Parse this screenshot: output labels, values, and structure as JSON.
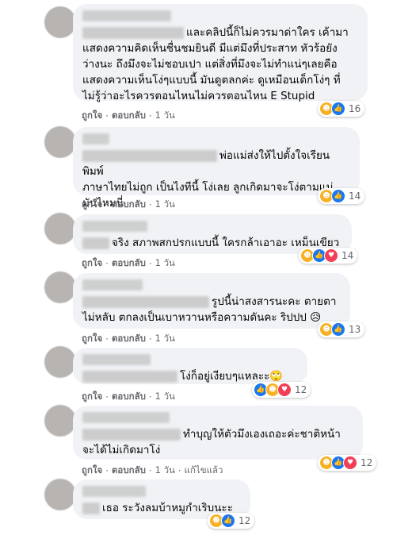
{
  "actions": {
    "like": "ถูกใจ",
    "reply": "ตอบกลับ",
    "sep": "·"
  },
  "comments": [
    {
      "lines": [
        "และคลิปนี้ก็ไม่ควรมาด่าใคร เค้ามา",
        "แสดงความคิดเห็นชื่นชมยินดี มีแต่มึงที่ประสาท หัวร้อยัง",
        "ว่างนะ ถึงมึงจะไม่ชอบเปา แต่สิ่งที่มึงจะไม่ทำแน่ๆเลยคือ",
        "แสดงความเห็นโง่ๆแบบนี้ มันดูตลกค่ะ ดูเหมือนเด็กโง่ๆ ที่",
        "ไม่รู้ว่าอะไรควรตอนไหนไม่ควรตอนไหน E Stupid"
      ],
      "time": "1 วัน",
      "count": "16",
      "reactions": [
        "haha",
        "like"
      ]
    },
    {
      "lines": [
        "พ่อแม่ส่งให้ไปตั้งใจเรียน พิมพ์",
        "ภาษาไทยไม่ถูก เป็นไงทีนี้ โง่เลย ลูกเกิดมาจะโง่ตามแม่",
        "มันไหมนี่"
      ],
      "time": "1 วัน",
      "count": "14",
      "reactions": [
        "haha",
        "like"
      ]
    },
    {
      "lines": [
        "จริง สภาพสกปรกแบบนี้ ใครกล้าเอาอะ เหม็นเขียว"
      ],
      "time": "1 วัน",
      "count": "14",
      "reactions": [
        "haha",
        "like",
        "love"
      ]
    },
    {
      "lines": [
        "รูปนี้น่าสงสารนะคะ ตายตา",
        "ไม่หลับ ตกลงเป็นเบาหวานหรือความดันคะ ริปปป 😥"
      ],
      "time": "1 วัน",
      "count": "13",
      "reactions": [
        "haha",
        "like"
      ]
    },
    {
      "lines": [
        "โง่ก็อยู่เงียบๆแหละะ🙄"
      ],
      "time": "1 วัน",
      "count": "12",
      "reactions": [
        "like",
        "haha",
        "love"
      ]
    },
    {
      "lines": [
        "ทำบุญให้ตัวมึงเองเถอะค่ะชาติหน้า",
        "จะได้ไม่เกิดมาโง่"
      ],
      "time": "1 วัน",
      "edited": "แก้ไขแล้ว",
      "count": "12",
      "reactions": [
        "haha",
        "like",
        "love"
      ]
    },
    {
      "lines": [
        "เธอ ระวังลมบ้าหมูกำเริบนะะ"
      ],
      "time": "",
      "count": "12",
      "reactions": [
        "haha",
        "like"
      ]
    }
  ]
}
